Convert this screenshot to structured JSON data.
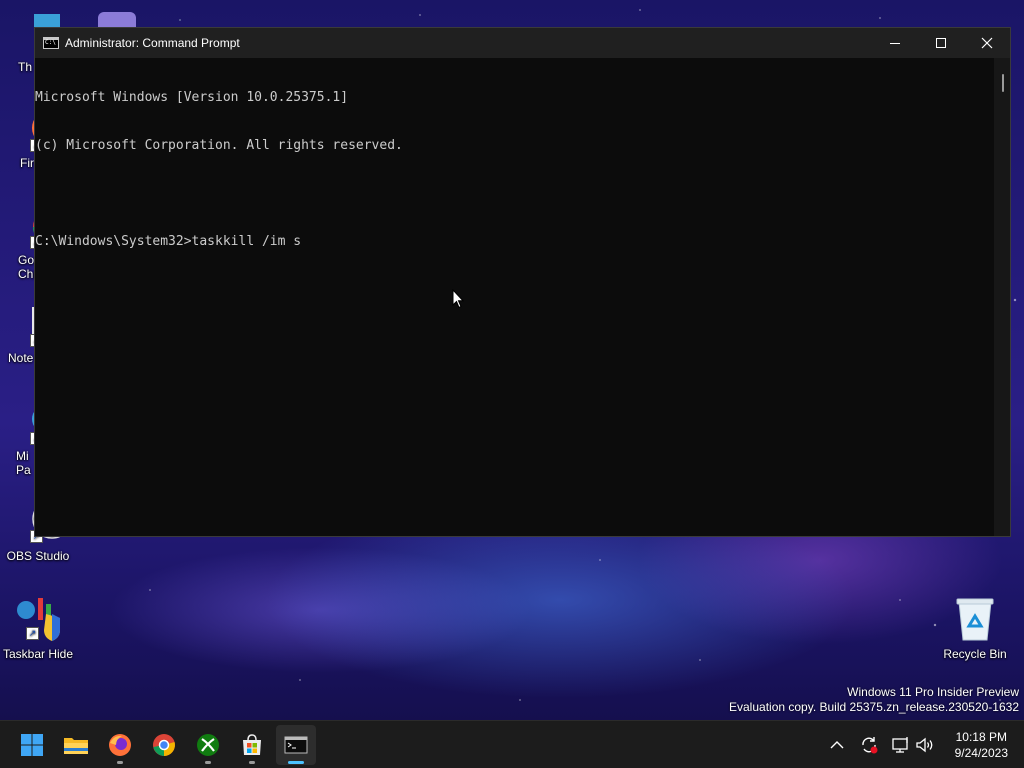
{
  "desktop": {
    "icons": [
      {
        "label": "Th"
      },
      {
        "label": "Fir"
      },
      {
        "label": "Go\nChr"
      },
      {
        "label": "Note"
      },
      {
        "label": "Mi\nPa"
      },
      {
        "label": "OBS Studio"
      },
      {
        "label": "Taskbar Hide"
      },
      {
        "label": "Recycle Bin"
      }
    ]
  },
  "window": {
    "title": "Administrator: Command Prompt",
    "app_icon_text": "C:\\"
  },
  "console": {
    "lines": [
      "Microsoft Windows [Version 10.0.25375.1]",
      "(c) Microsoft Corporation. All rights reserved.",
      "",
      "C:\\Windows\\System32>taskkill /im s"
    ]
  },
  "watermark": {
    "line1": "Windows 11 Pro Insider Preview",
    "line2": "Evaluation copy. Build 25375.zn_release.230520-1632"
  },
  "taskbar": {
    "apps": [
      {
        "name": "Start",
        "icon": "windows-start-icon"
      },
      {
        "name": "File Explorer",
        "icon": "folder-icon"
      },
      {
        "name": "Firefox",
        "icon": "firefox-icon"
      },
      {
        "name": "Google Chrome",
        "icon": "chrome-icon"
      },
      {
        "name": "Xbox",
        "icon": "xbox-icon"
      },
      {
        "name": "Microsoft Store",
        "icon": "store-icon"
      },
      {
        "name": "Command Prompt",
        "icon": "terminal-icon",
        "active": true
      }
    ],
    "time": "10:18 PM",
    "date": "9/24/2023"
  }
}
